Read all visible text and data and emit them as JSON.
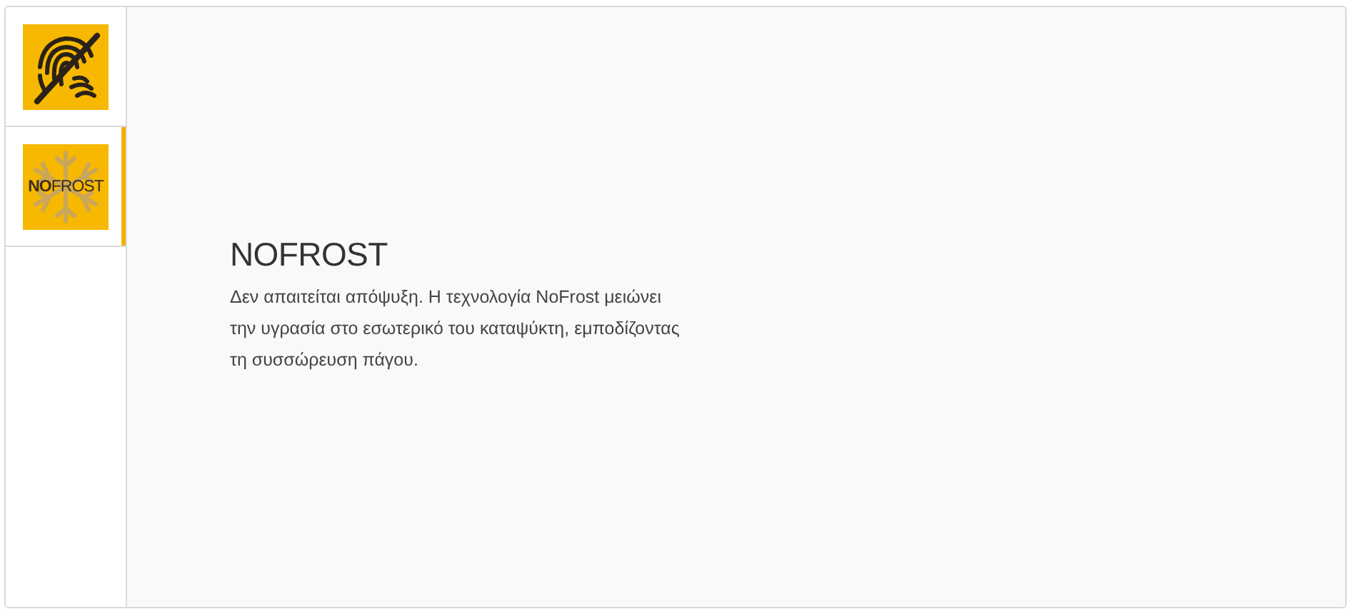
{
  "tabs": [
    {
      "kind": "fingerprint-off",
      "selected": false
    },
    {
      "kind": "nofrost",
      "logo_text": "**NO**FROST",
      "selected": true
    }
  ],
  "feature": {
    "title": "NOFROST",
    "description": "Δεν απαιτείται απόψυξη. Η τεχνολογία NoFrost μειώνει την υγρασία στο εσωτερικό του καταψύκτη, εμποδίζοντας τη συσσώρευση πάγου."
  }
}
